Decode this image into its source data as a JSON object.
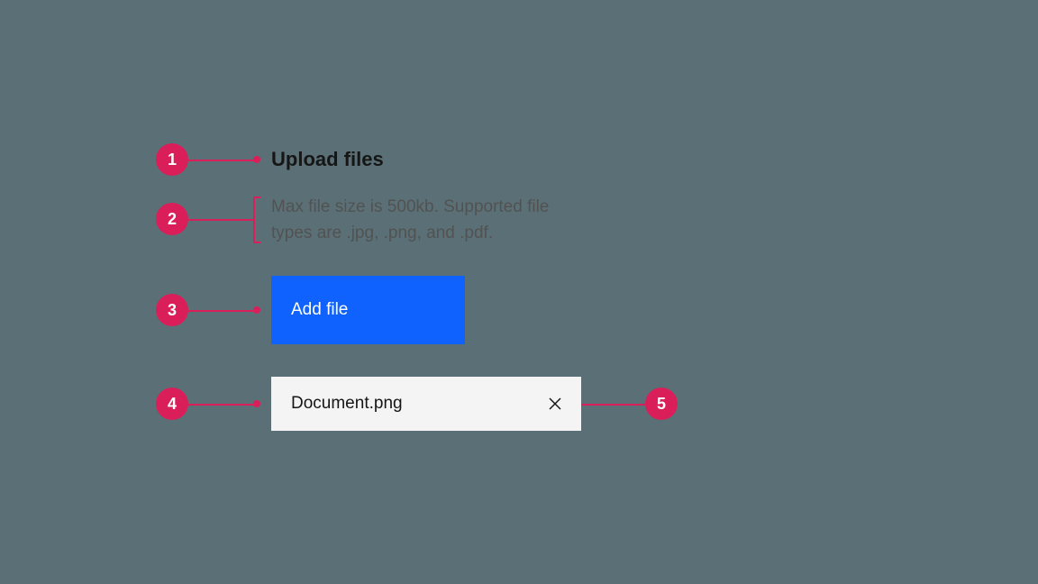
{
  "annotations": {
    "1": "1",
    "2": "2",
    "3": "3",
    "4": "4",
    "5": "5"
  },
  "uploader": {
    "heading": "Upload files",
    "description": "Max file size is 500kb. Supported file types are .jpg, .png, and .pdf.",
    "add_button_label": "Add file",
    "file_name": "Document.png"
  },
  "colors": {
    "annotation": "#da1e5a",
    "primary_button": "#0f62fe",
    "background": "#5a7076"
  }
}
